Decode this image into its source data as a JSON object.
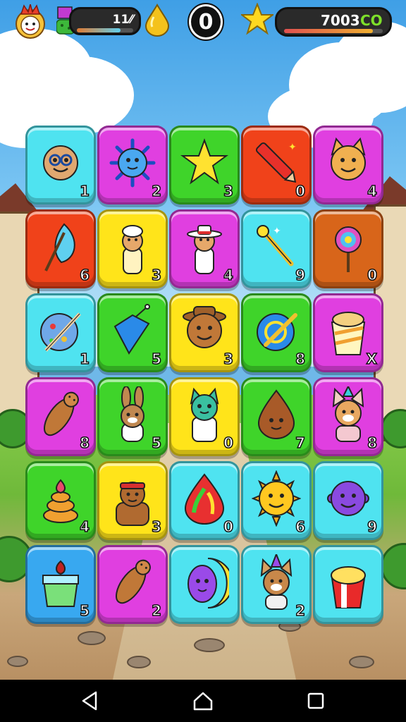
{
  "hud": {
    "level_progress_text": "11⁄⁄",
    "level_progress_fraction": 0.78,
    "center_counter": "0",
    "coins_text": "7003",
    "currency_label": "CO",
    "coins_progress_fraction": 0.9
  },
  "colors": {
    "cyan": "#4fe3f0",
    "magenta": "#e03fe0",
    "green": "#3fd42a",
    "red": "#f0421a",
    "yellow": "#ffe41a",
    "brown": "#d8651a",
    "blue": "#38a8f0"
  },
  "board": {
    "rows": [
      [
        {
          "icon": "bald-face-icon",
          "color": "cyan",
          "number": "1"
        },
        {
          "icon": "sun-blob-icon",
          "color": "magenta",
          "number": "2"
        },
        {
          "icon": "star-icon",
          "color": "green",
          "number": "3"
        },
        {
          "icon": "crayon-icon",
          "color": "red",
          "number": "0"
        },
        {
          "icon": "cat-face-icon",
          "color": "magenta",
          "number": "4"
        }
      ],
      [
        {
          "icon": "feather-icon",
          "color": "red",
          "number": "6"
        },
        {
          "icon": "chef-figure-icon",
          "color": "yellow",
          "number": "3"
        },
        {
          "icon": "hat-figure-icon",
          "color": "magenta",
          "number": "4"
        },
        {
          "icon": "wand-icon",
          "color": "cyan",
          "number": "9"
        },
        {
          "icon": "lollipop-icon",
          "color": "brown",
          "number": "0"
        }
      ],
      [
        {
          "icon": "paint-ball-icon",
          "color": "cyan",
          "number": "1"
        },
        {
          "icon": "blue-kite-icon",
          "color": "green",
          "number": "5"
        },
        {
          "icon": "cowboy-face-icon",
          "color": "yellow",
          "number": "3"
        },
        {
          "icon": "globe-pen-icon",
          "color": "green",
          "number": "8"
        },
        {
          "icon": "ice-cream-cup-icon",
          "color": "magenta",
          "number": "X"
        }
      ],
      [
        {
          "icon": "lying-dog-icon",
          "color": "magenta",
          "number": "8"
        },
        {
          "icon": "bunny-icon",
          "color": "green",
          "number": "5"
        },
        {
          "icon": "green-cat-icon",
          "color": "yellow",
          "number": "0"
        },
        {
          "icon": "brown-drop-face-icon",
          "color": "green",
          "number": "7"
        },
        {
          "icon": "party-fox-icon",
          "color": "magenta",
          "number": "8"
        }
      ],
      [
        {
          "icon": "swirl-cake-icon",
          "color": "green",
          "number": "4"
        },
        {
          "icon": "bandana-man-icon",
          "color": "yellow",
          "number": "3"
        },
        {
          "icon": "rainbow-drop-icon",
          "color": "cyan",
          "number": "0"
        },
        {
          "icon": "sun-face-icon",
          "color": "cyan",
          "number": "6"
        },
        {
          "icon": "purple-ball-face-icon",
          "color": "cyan",
          "number": "9"
        }
      ],
      [
        {
          "icon": "drink-cup-icon",
          "color": "blue",
          "number": "5"
        },
        {
          "icon": "lying-dog-icon",
          "color": "magenta",
          "number": "2"
        },
        {
          "icon": "moon-egg-icon",
          "color": "cyan",
          "number": ""
        },
        {
          "icon": "party-cat-icon",
          "color": "cyan",
          "number": "2"
        },
        {
          "icon": "popcorn-cup-icon",
          "color": "cyan",
          "number": ""
        }
      ]
    ]
  }
}
